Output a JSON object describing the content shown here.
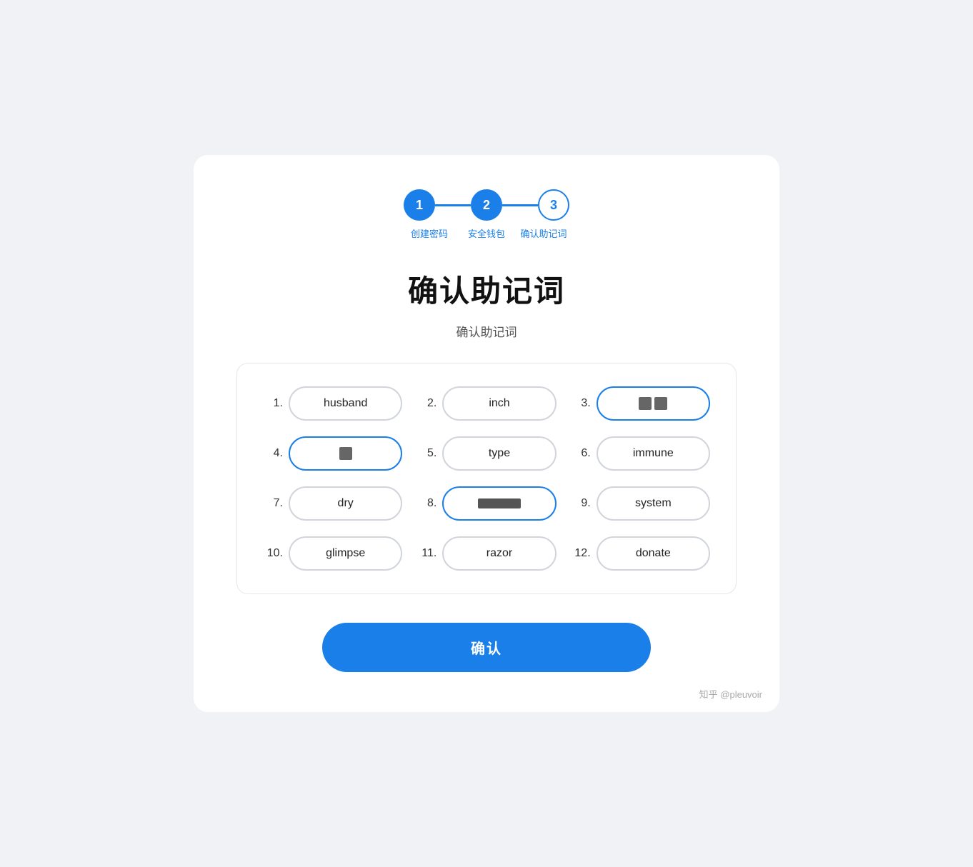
{
  "steps": {
    "items": [
      {
        "label": "1",
        "type": "active"
      },
      {
        "label": "2",
        "type": "active"
      },
      {
        "label": "3",
        "type": "outline"
      }
    ],
    "labels": [
      {
        "text": "创建密码"
      },
      {
        "text": "安全钱包"
      },
      {
        "text": "确认助记\n词"
      }
    ],
    "line_color": "#1a7fe8"
  },
  "page": {
    "title": "确认助记词",
    "subtitle": "确认助记词"
  },
  "words": [
    {
      "number": "1.",
      "word": "husband",
      "highlighted": false,
      "blurred": false
    },
    {
      "number": "2.",
      "word": "inch",
      "highlighted": false,
      "blurred": false
    },
    {
      "number": "3.",
      "word": "",
      "highlighted": true,
      "blurred": true,
      "blur_type": "two_blocks"
    },
    {
      "number": "4.",
      "word": "",
      "highlighted": true,
      "blurred": true,
      "blur_type": "one_block"
    },
    {
      "number": "5.",
      "word": "type",
      "highlighted": false,
      "blurred": false
    },
    {
      "number": "6.",
      "word": "immune",
      "highlighted": false,
      "blurred": false
    },
    {
      "number": "7.",
      "word": "dry",
      "highlighted": false,
      "blurred": false
    },
    {
      "number": "8.",
      "word": "",
      "highlighted": true,
      "blurred": true,
      "blur_type": "wide_block"
    },
    {
      "number": "9.",
      "word": "system",
      "highlighted": false,
      "blurred": false
    },
    {
      "number": "10.",
      "word": "glimpse",
      "highlighted": false,
      "blurred": false
    },
    {
      "number": "11.",
      "word": "razor",
      "highlighted": false,
      "blurred": false
    },
    {
      "number": "12.",
      "word": "donate",
      "highlighted": false,
      "blurred": false
    }
  ],
  "confirm_button": {
    "label": "确认"
  },
  "watermark": "知乎 @pleuvoir"
}
